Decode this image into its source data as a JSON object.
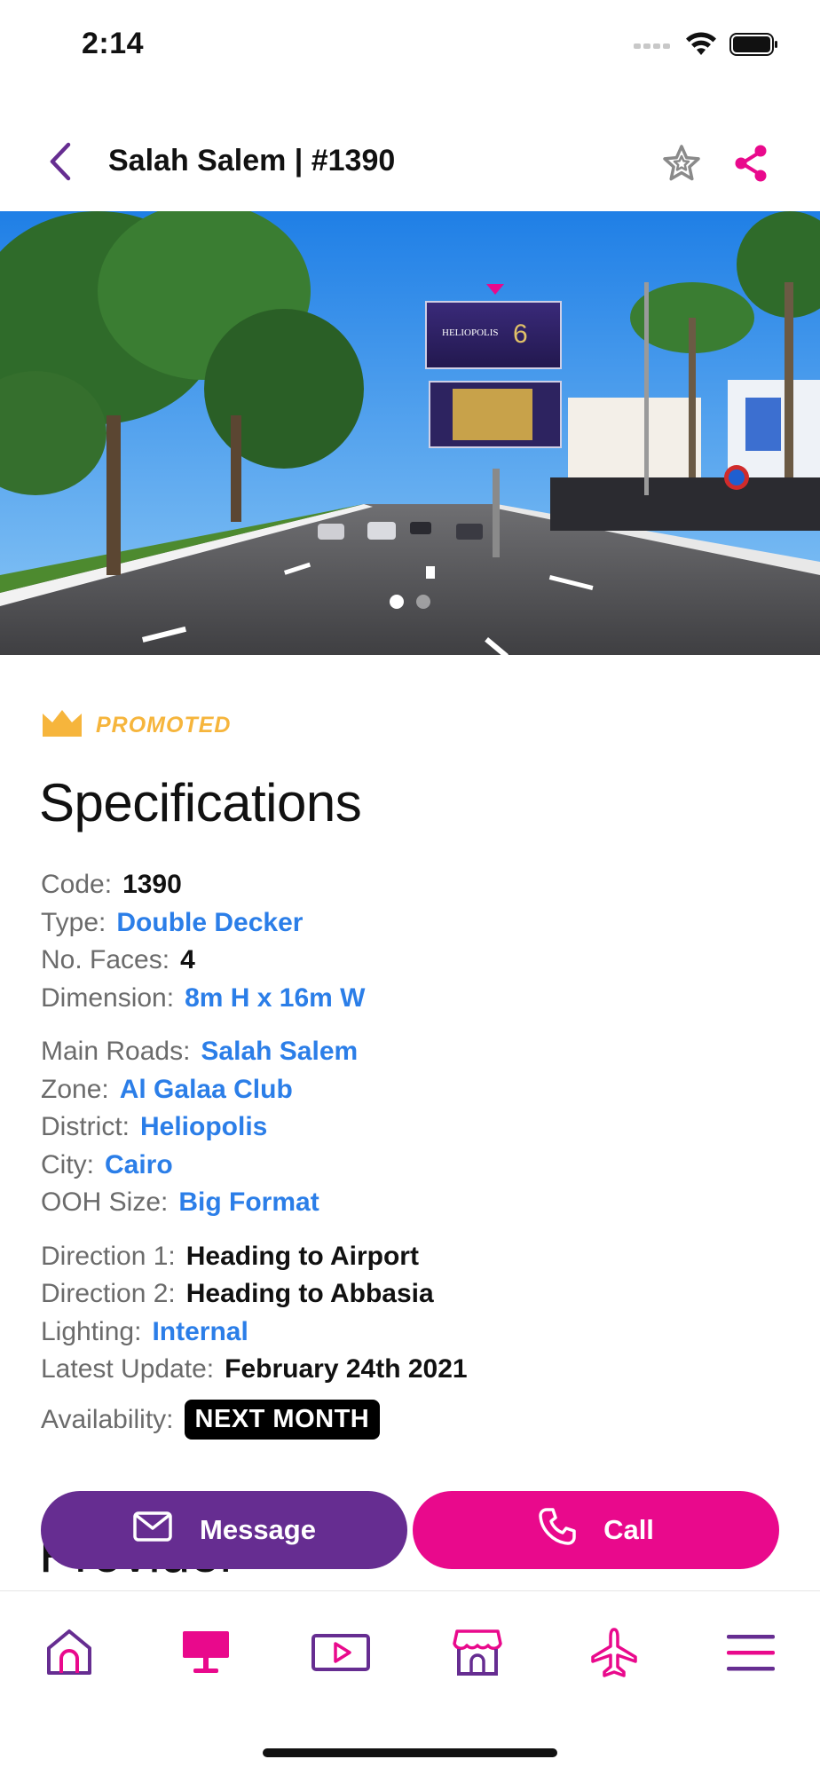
{
  "status_bar": {
    "time": "2:14"
  },
  "header": {
    "title": "Salah Salem | #1390"
  },
  "gallery": {
    "image_count": 2,
    "active_index": 0
  },
  "promoted": {
    "label": "PROMOTED"
  },
  "specifications": {
    "title": "Specifications",
    "groups": [
      [
        {
          "key": "Code:",
          "value": "1390",
          "link": false
        },
        {
          "key": "Type:",
          "value": "Double Decker",
          "link": true
        },
        {
          "key": "No. Faces:",
          "value": "4",
          "link": false
        },
        {
          "key": "Dimension:",
          "value": "8m H x 16m W",
          "link": true
        }
      ],
      [
        {
          "key": "Main Roads:",
          "value": "Salah Salem",
          "link": true
        },
        {
          "key": "Zone:",
          "value": "Al Galaa Club",
          "link": true
        },
        {
          "key": "District:",
          "value": "Heliopolis",
          "link": true
        },
        {
          "key": "City:",
          "value": "Cairo",
          "link": true
        },
        {
          "key": "OOH Size:",
          "value": "Big Format",
          "link": true
        }
      ],
      [
        {
          "key": "Direction 1:",
          "value": "Heading to Airport",
          "link": false
        },
        {
          "key": "Direction 2:",
          "value": "Heading to Abbasia",
          "link": false
        },
        {
          "key": "Lighting:",
          "value": "Internal",
          "link": true
        },
        {
          "key": "Latest Update:",
          "value": "February 24th 2021",
          "link": false
        }
      ]
    ],
    "availability_key": "Availability:",
    "availability_value": "NEXT MONTH"
  },
  "provider": {
    "title": "Provider"
  },
  "actions": {
    "message_label": "Message",
    "call_label": "Call"
  },
  "tabbar": {
    "tabs": [
      {
        "icon": "home-icon",
        "active": false
      },
      {
        "icon": "billboard-icon",
        "active": true
      },
      {
        "icon": "video-icon",
        "active": false
      },
      {
        "icon": "store-icon",
        "active": false
      },
      {
        "icon": "airplane-icon",
        "active": false
      },
      {
        "icon": "menu-icon",
        "active": false
      }
    ]
  },
  "colors": {
    "primary_purple": "#662d91",
    "accent_pink": "#e9098c",
    "link_blue": "#2b7ee8",
    "promoted_gold": "#f6b53c"
  }
}
